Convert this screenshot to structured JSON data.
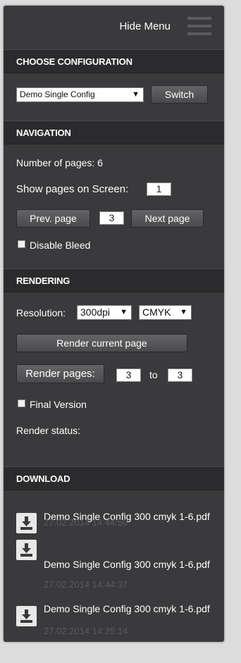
{
  "header": {
    "hide_menu_label": "Hide Menu"
  },
  "configuration": {
    "title": "CHOOSE CONFIGURATION",
    "selected": "Demo Single Config",
    "switch_label": "Switch"
  },
  "navigation": {
    "title": "NAVIGATION",
    "pages_text": "Number of pages: 6",
    "show_pages_label": "Show pages on Screen:",
    "show_pages_value": "1",
    "prev_label": "Prev. page",
    "current_page": "3",
    "next_label": "Next page",
    "disable_bleed_label": "Disable Bleed"
  },
  "rendering": {
    "title": "RENDERING",
    "resolution_label": "Resolution:",
    "resolution_value": "300dpi",
    "colorspace_value": "CMYK",
    "render_current_label": "Render current page",
    "render_pages_label": "Render pages:",
    "from_page": "3",
    "to_label": "to",
    "to_page": "3",
    "final_version_label": "Final Version",
    "status_label": "Render status:"
  },
  "download": {
    "title": "DOWNLOAD",
    "items": [
      {
        "name": "Demo Single Config 300 cmyk 1-6.pdf",
        "date": "27.02.2014 14:44:50"
      },
      {
        "name": "Demo Single Config 300 cmyk 1-6.pdf",
        "date": "27.02.2014 14:44:37"
      },
      {
        "name": "Demo Single Config 300 cmyk 1-6.pdf",
        "date": "27.02.2014 14:25:14"
      }
    ]
  },
  "colors": {
    "panel_bg": "#3a3a3c",
    "header_bg": "#2b2b2d",
    "page_bg": "#dcdcdc",
    "date_text": "#5a5a5c"
  },
  "icons": {
    "menu": "hamburger-icon",
    "dropdown": "triangle-down",
    "download": "download-arrow-icon"
  }
}
